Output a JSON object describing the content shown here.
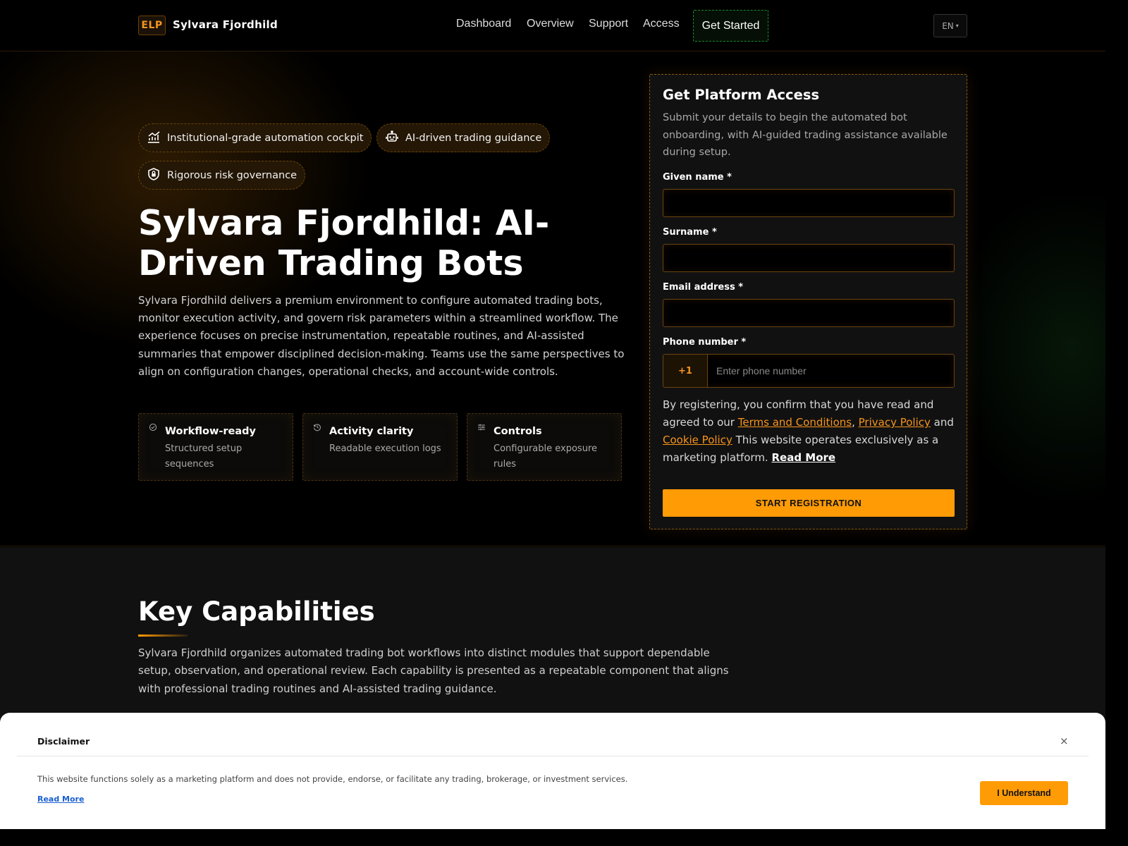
{
  "header": {
    "logo_badge": "ELP",
    "brand": "Sylvara Fjordhild",
    "nav": [
      "Dashboard",
      "Overview",
      "Support",
      "Access"
    ],
    "cta": "Get Started",
    "language": "EN"
  },
  "hero": {
    "pills": [
      {
        "label": "Institutional-grade automation cockpit",
        "icon": "chart-icon"
      },
      {
        "label": "AI-driven trading guidance",
        "icon": "robot-icon"
      },
      {
        "label": "Rigorous risk governance",
        "icon": "shield-lock-icon"
      }
    ],
    "title": "Sylvara Fjordhild: AI-Driven Trading Bots",
    "description": "Sylvara Fjordhild delivers a premium environment to configure automated trading bots, monitor execution activity, and govern risk parameters within a streamlined workflow. The experience focuses on precise instrumentation, repeatable routines, and AI-assisted summaries that empower disciplined decision-making. Teams use the same perspectives to align on configuration changes, operational checks, and account-wide controls.",
    "features": [
      {
        "title": "Workflow-ready",
        "desc": "Structured setup sequences",
        "icon": "check-circle-icon"
      },
      {
        "title": "Activity clarity",
        "desc": "Readable execution logs",
        "icon": "history-icon"
      },
      {
        "title": "Controls",
        "desc": "Configurable exposure rules",
        "icon": "sliders-icon"
      }
    ]
  },
  "form": {
    "title": "Get Platform Access",
    "subtitle": "Submit your details to begin the automated bot onboarding, with AI-guided trading assistance available during setup.",
    "given_name_label": "Given name *",
    "surname_label": "Surname *",
    "email_label": "Email address *",
    "phone_label": "Phone number *",
    "phone_code": "+1",
    "phone_placeholder": "Enter phone number",
    "consent_prefix": "By registering, you confirm that you have read and agreed to our",
    "terms": "Terms and Conditions",
    "privacy": "Privacy Policy",
    "and": "and",
    "cookie": "Cookie Policy",
    "consent_suffix": "This website operates exclusively as a marketing platform.",
    "read_more": "Read More",
    "submit": "START REGISTRATION"
  },
  "capabilities": {
    "title": "Key Capabilities",
    "description": "Sylvara Fjordhild organizes automated trading bot workflows into distinct modules that support dependable setup, observation, and operational review. Each capability is presented as a repeatable component that aligns with professional trading routines and AI-assisted trading guidance."
  },
  "disclaimer": {
    "title": "Disclaimer",
    "close": "×",
    "text": "This website functions solely as a marketing platform and does not provide, endorse, or facilitate any trading, brokerage, or investment services.",
    "read_more": "Read More",
    "button": "I Understand"
  },
  "colors": {
    "accent": "#ff9b05",
    "accent_text": "#f7941d",
    "cta_border": "#1e8a2e",
    "background": "#000000",
    "panel": "#111111"
  }
}
